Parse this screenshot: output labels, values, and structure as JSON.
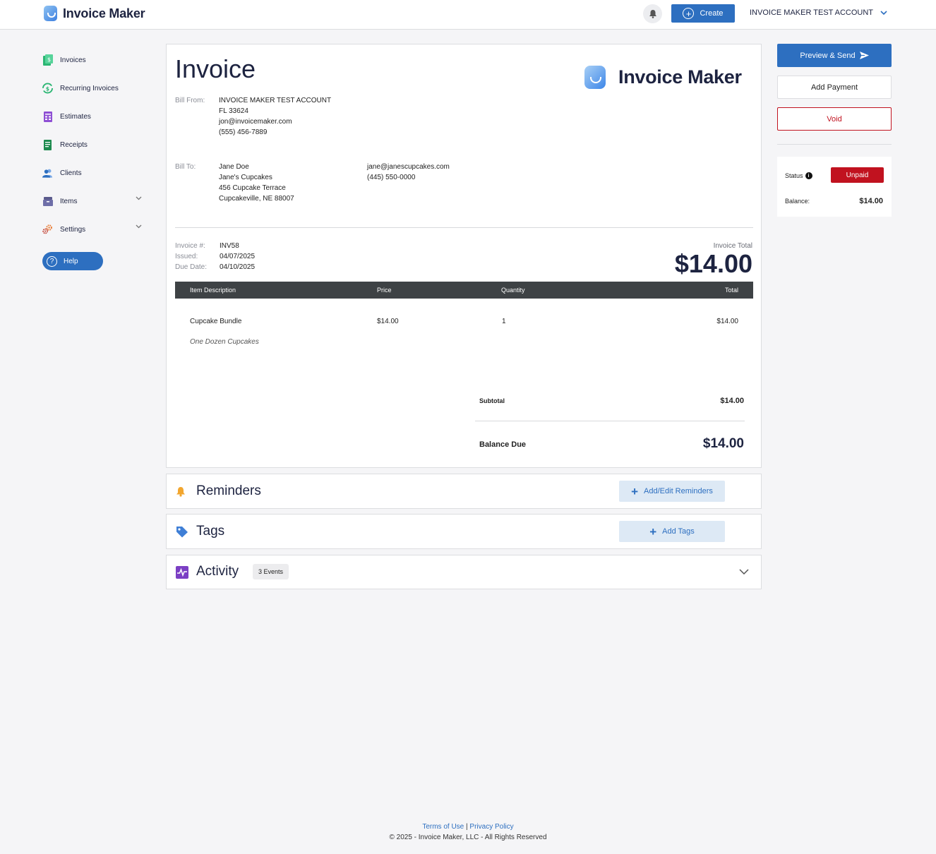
{
  "topbar": {
    "brand": "Invoice Maker",
    "create_label": "Create",
    "account_name": "INVOICE MAKER TEST ACCOUNT"
  },
  "sidebar": {
    "items": [
      {
        "label": "Invoices",
        "icon": "invoice-icon"
      },
      {
        "label": "Recurring Invoices",
        "icon": "recurring-icon"
      },
      {
        "label": "Estimates",
        "icon": "estimate-icon"
      },
      {
        "label": "Receipts",
        "icon": "receipt-icon"
      },
      {
        "label": "Clients",
        "icon": "clients-icon"
      },
      {
        "label": "Items",
        "icon": "items-icon"
      },
      {
        "label": "Settings",
        "icon": "settings-icon"
      }
    ],
    "help_label": "Help"
  },
  "invoice": {
    "title": "Invoice",
    "logo_text": "Invoice Maker",
    "bill_from_label": "Bill From:",
    "bill_from": {
      "name": "INVOICE MAKER TEST ACCOUNT",
      "address": "FL 33624",
      "email": "jon@invoicemaker.com",
      "phone": "(555) 456-7889"
    },
    "bill_to_label": "Bill To:",
    "bill_to": {
      "name": "Jane Doe",
      "company": "Jane's Cupcakes",
      "street": "456 Cupcake Terrace",
      "city": "Cupcakeville, NE 88007",
      "email": "jane@janescupcakes.com",
      "phone": "(445) 550-0000"
    },
    "number_label": "Invoice #:",
    "number": "INV58",
    "issued_label": "Issued:",
    "issued": "04/07/2025",
    "due_label": "Due Date:",
    "due": "04/10/2025",
    "total_label": "Invoice Total",
    "total": "$14.00",
    "columns": [
      "Item Description",
      "Price",
      "Quantity",
      "Total"
    ],
    "items": [
      {
        "name": "Cupcake Bundle",
        "price": "$14.00",
        "quantity": "1",
        "total": "$14.00",
        "description": "One Dozen Cupcakes"
      }
    ],
    "subtotal_label": "Subtotal",
    "subtotal": "$14.00",
    "balance_due_label": "Balance Due",
    "balance_due": "$14.00"
  },
  "sections": {
    "reminders": {
      "title": "Reminders",
      "button": "Add/Edit Reminders"
    },
    "tags": {
      "title": "Tags",
      "button": "Add Tags"
    },
    "activity": {
      "title": "Activity",
      "badge": "3 Events"
    }
  },
  "actions": {
    "preview_send": "Preview & Send",
    "add_payment": "Add Payment",
    "void": "Void"
  },
  "status_panel": {
    "status_label": "Status",
    "status": "Unpaid",
    "balance_label": "Balance:",
    "balance": "$14.00"
  },
  "footer": {
    "terms": "Terms of Use",
    "separator": "|",
    "privacy": "Privacy Policy",
    "copyright": "© 2025 - Invoice Maker, LLC - All Rights Reserved"
  },
  "colors": {
    "primary": "#2d6fc0",
    "danger": "#c1121f",
    "table_header": "#3e4245",
    "text_dark": "#1d2340"
  }
}
